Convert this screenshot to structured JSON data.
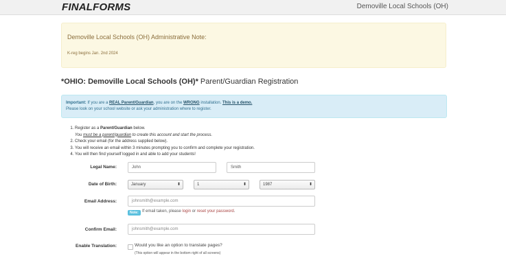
{
  "header": {
    "logo": "FINALFORMS",
    "org_name": "Demoville Local Schools (OH)"
  },
  "admin_note": {
    "title": "Demoville Local Schools (OH) Administrative Note:",
    "text": "K-reg begins Jan. 2nd 2024"
  },
  "page": {
    "title_bold": "*OHIO: Demoville Local Schools (OH)*",
    "title_rest": " Parent/Guardian Registration"
  },
  "info": {
    "important": "Important:",
    "t1": " If you are a ",
    "link_parent": "REAL Parent/Guardian",
    "t2": ", you are on the ",
    "link_wrong": "WRONG",
    "t3": " installation. ",
    "link_demo": "This is a demo.",
    "line2": "Please look on your school website or ask your administration where to register."
  },
  "steps": {
    "s1_a": "Register as a ",
    "s1_b": "Parent/Guardian",
    "s1_c": " below.",
    "s1_sub_a": "You ",
    "s1_sub_b": "must be a parent/guardian",
    "s1_sub_c": " to create this account and start the process.",
    "s2": "Check your email (for the address supplied below).",
    "s3": "You will receive an email within 3 minutes prompting you to confirm and complete your registration.",
    "s4": "You will then find yourself logged in and able to add your students!"
  },
  "form": {
    "legal_name_label": "Legal Name:",
    "first_name": "John",
    "last_name": "Smith",
    "dob_label": "Date of Birth:",
    "dob_month": "January",
    "dob_day": "1",
    "dob_year": "1987",
    "email_label": "Email Address:",
    "email_placeholder": "johnsmith@example.com",
    "note_badge": "Note:",
    "note_a": "If email taken, please ",
    "note_login": "login",
    "note_or": " or ",
    "note_reset": "reset your password",
    "note_end": ".",
    "confirm_label": "Confirm Email:",
    "confirm_placeholder": "johnsmith@example.com",
    "translation_label": "Enable Translation:",
    "translation_question": "Would you like an option to translate pages?",
    "translation_sub": "(This option will appear in the bottom right of all screens)"
  }
}
